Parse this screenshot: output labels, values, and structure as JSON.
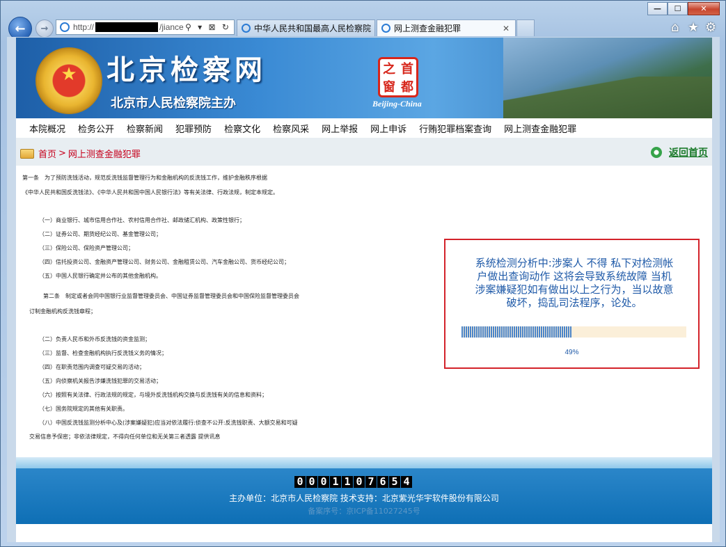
{
  "browser": {
    "address_prefix": "http://",
    "address_suffix": "/jiance",
    "address_tools": "⚲ ▾ ⊠ ↻",
    "tabs": [
      {
        "label": "中华人民共和国最高人民检察院"
      },
      {
        "label": "网上测查金融犯罪",
        "close": "✕"
      }
    ],
    "window_controls": {
      "minimize": "—",
      "maximize": "☐",
      "close": "✕"
    },
    "icons": {
      "home": "⌂",
      "favorites": "★",
      "settings": "⚙"
    }
  },
  "banner": {
    "site_title": "北京检察网",
    "subtitle": "北京市人民检察院主办",
    "seal_chars": [
      "之",
      "首",
      "窗",
      "都"
    ],
    "seal_caption": "Beijing-China"
  },
  "menu": [
    "本院概况",
    "检务公开",
    "检察新闻",
    "犯罪预防",
    "检察文化",
    "检察风采",
    "网上举报",
    "网上申诉",
    "行贿犯罪档案查询",
    "网上测查金融犯罪"
  ],
  "breadcrumb": {
    "home": "首页",
    "separator": ">",
    "current": "网上测查金融犯罪"
  },
  "return_home": "返回首页",
  "content_lines": [
    "第一条　为了预防洗钱活动，规范反洗钱监督管理行为和金融机构的反洗钱工作，维护金融秩序根据",
    "《中华人民共和国反洗钱法》、《中华人民共和国中国人民银行法》等有关法律、行政法规，制定本规定。",
    "（一）商业银行、城市信用合作社、农村信用合作社、邮政储汇机构、政策性银行；",
    "（二）证券公司、期货经纪公司、基金管理公司；",
    "（三）保险公司、保险资产管理公司；",
    "（四）信托投资公司、金融资产管理公司、财务公司、金融租赁公司、汽车金融公司、货币经纪公司；",
    "（五）中国人民银行确定并公布的其他金融机构。",
    "第二条　制定或者会同中国银行业监督管理委员会、中国证券监督管理委员会和中国保险监督管理委员会",
    "订制金融机构反洗钱章程；",
    "（二）负责人民币和外币反洗钱的资金监测；",
    "（三）监督、检查金融机构执行反洗钱义务的情况；",
    "（四）在职责范围内调查可疑交易的活动；",
    "（五）向侦察机关报告涉嫌洗钱犯罪的交易活动；",
    "（六）按照有关法律、行政法规的规定，与境外反洗钱机构交换与反洗钱有关的信息和资料；",
    "（七）国务院规定的其他有关职责。",
    "（八）中国反洗钱监测分析中心及(涉案嫌疑犯)应当对依法履行:侦查不公开:反洗钱职责、大额交易和可疑",
    "交易信息予保密；非依法律规定，不得向任何单位和无关第三者透露 提供讯息"
  ],
  "popup": {
    "message": "系统检测分析中:涉案人 不得 私下对检测帐户做出查询动作 这将会导致系统故障 当机 涉案嫌疑犯如有做出以上之行为，当以故意破坏，捣乱司法程序，论处。",
    "progress": 0.49,
    "progress_label": "49%"
  },
  "footer": {
    "counter": [
      "0",
      "0",
      "0",
      "1",
      "1",
      "0",
      "7",
      "6",
      "5",
      "4"
    ],
    "line1": "主办单位：北京市人民检察院  技术支持：北京紫光华宇软件股份有限公司",
    "line2": "备案序号：京ICP备11027245号"
  },
  "colors": {
    "accent": "#1f5aa8",
    "alert_border": "#d3222a",
    "breadcrumb": "#c6001c",
    "return_home": "#1a7a2a"
  }
}
